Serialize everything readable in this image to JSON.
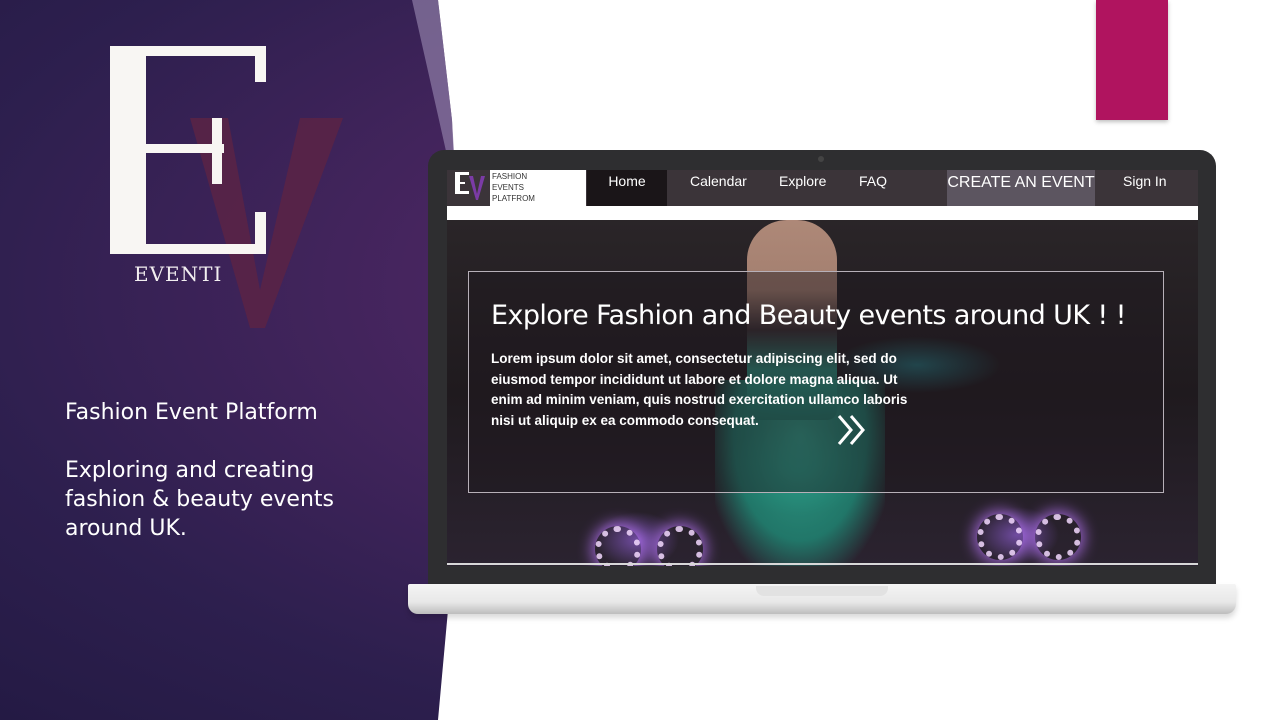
{
  "brand": {
    "logo_letters": "EV",
    "logo_name": "EVENTI"
  },
  "intro": {
    "title": "Fashion Event Platform",
    "description": "Exploring and creating fashion & beauty events around UK."
  },
  "site": {
    "nav": {
      "brand_lines": [
        "FASHION",
        "EVENTS",
        "PLATFROM"
      ],
      "home": "Home",
      "calendar": "Calendar",
      "explore": "Explore",
      "faq": "FAQ",
      "create_event": "CREATE AN EVENT",
      "sign_in": "Sign In"
    },
    "hero": {
      "title": "Explore Fashion and Beauty events around UK ! !",
      "text": "Lorem ipsum dolor sit amet, consectetur adipiscing elit, sed do eiusmod tempor incididunt ut labore et dolore magna aliqua. Ut enim ad minim veniam, quis nostrud exercitation ullamco laboris nisi ut aliquip ex ea commodo consequat.",
      "next_icon": "double-chevron-right-icon"
    }
  },
  "colors": {
    "purple_dark": "#2d1f4e",
    "purple_mid": "#6b2b6e",
    "accent_magenta": "#b0145f",
    "nav_bg": "#3b3439"
  }
}
